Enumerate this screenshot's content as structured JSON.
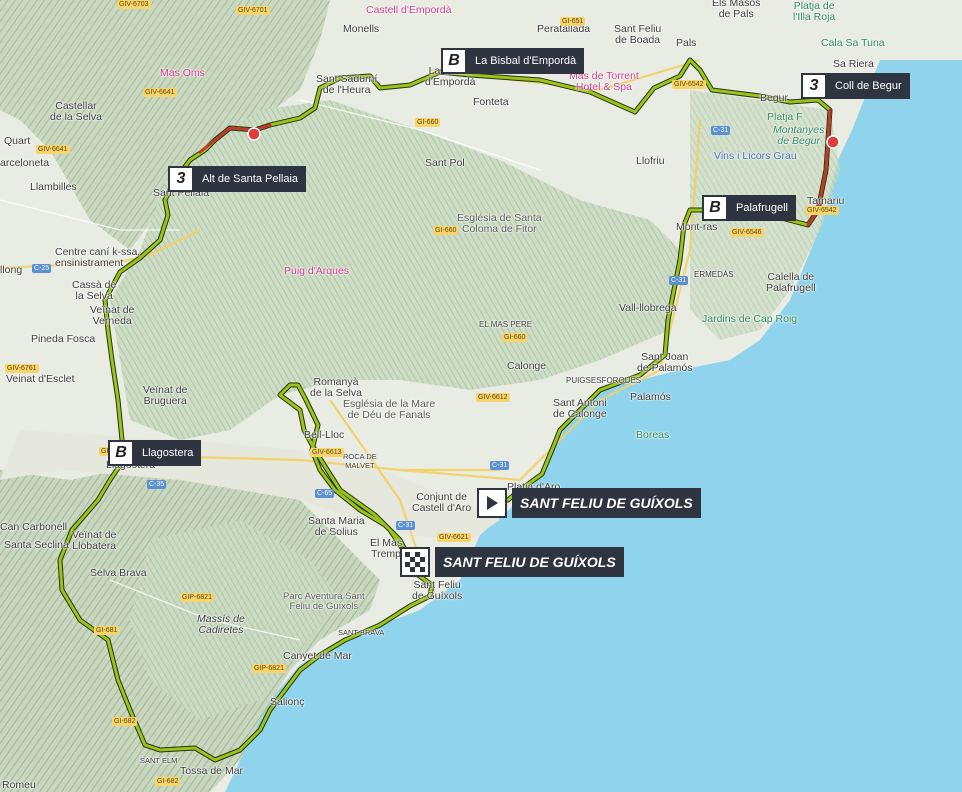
{
  "map": {
    "places": [
      {
        "id": "monells",
        "text": "Monells"
      },
      {
        "id": "peratallada",
        "text": "Peratallada"
      },
      {
        "id": "santfeliuboada",
        "text": "Sant Feliu\nde Boada"
      },
      {
        "id": "masos",
        "text": "Els Masos\nde Pals"
      },
      {
        "id": "pals",
        "text": "Pals"
      },
      {
        "id": "castellar",
        "text": "Castellar\nde la Selva"
      },
      {
        "id": "quart",
        "text": "Quart"
      },
      {
        "id": "barcelona",
        "text": "arceloneta"
      },
      {
        "id": "llambilles",
        "text": "Llambilles"
      },
      {
        "id": "santsadurni",
        "text": "Sant Sadurní\nde l'Heura"
      },
      {
        "id": "labisbal",
        "text": "La Bisbal\nd'Empordà"
      },
      {
        "id": "fonteta",
        "text": "Fonteta"
      },
      {
        "id": "santpol",
        "text": "Sant Pol"
      },
      {
        "id": "llofriu",
        "text": "Llofriu"
      },
      {
        "id": "santpellaia",
        "text": "Sant Pellaia"
      },
      {
        "id": "centrecani",
        "text": "Centre caní k-ssa,\nensinistrament"
      },
      {
        "id": "llong",
        "text": "llong"
      },
      {
        "id": "cassa",
        "text": "Cassà de\nla Selva"
      },
      {
        "id": "veinatverneda",
        "text": "Veïnat de\nVerneda"
      },
      {
        "id": "pineda",
        "text": "Pineda Fosca"
      },
      {
        "id": "veinatesclet",
        "text": "Veinat d'Esclet"
      },
      {
        "id": "veinatbruguera",
        "text": "Veïnat de\nBruguera"
      },
      {
        "id": "romanya",
        "text": "Romanyà\nde la Selva"
      },
      {
        "id": "elmaspere",
        "text": "EL MAS PERE"
      },
      {
        "id": "calonge",
        "text": "Calonge"
      },
      {
        "id": "vallllobrega",
        "text": "Vall-llobrega"
      },
      {
        "id": "montras",
        "text": "Mont-ras"
      },
      {
        "id": "ermedas",
        "text": "ERMEDÀS"
      },
      {
        "id": "calella",
        "text": "Calella de\nPalafrugell"
      },
      {
        "id": "jardins",
        "text": "Jardins de Cap Roig"
      },
      {
        "id": "santjoan",
        "text": "Sant Joan\nde Palamós"
      },
      {
        "id": "puigses",
        "text": "PUIGSESFORQUES"
      },
      {
        "id": "palamos",
        "text": "Palamós"
      },
      {
        "id": "santantoni",
        "text": "Sant Antoni\nde Calonge"
      },
      {
        "id": "boreas",
        "text": "Boreas"
      },
      {
        "id": "bellloc",
        "text": "Bell-Lloc"
      },
      {
        "id": "rocamalvet",
        "text": "ROCA DE\nMALVET"
      },
      {
        "id": "platjaaro",
        "text": "Platja d'Aro"
      },
      {
        "id": "conjunt",
        "text": "Conjunt de\nCastell d'Aro"
      },
      {
        "id": "santamaria",
        "text": "Santa Maria\nde Solius"
      },
      {
        "id": "elmas",
        "text": "El Mas\nTremp"
      },
      {
        "id": "santfeliu",
        "text": "Sant Feliu\nde Guíxols"
      },
      {
        "id": "llagostera",
        "text": "Llagostera"
      },
      {
        "id": "cancarbonell",
        "text": "Can Carbonell"
      },
      {
        "id": "santasecl",
        "text": "Santa Seclina"
      },
      {
        "id": "veinatllobatera",
        "text": "Veïnat de\nLlobatera"
      },
      {
        "id": "selvabrava",
        "text": "Selva Brava"
      },
      {
        "id": "parc",
        "text": "Parc Aventura Sant\nFeliu de Guíxols"
      },
      {
        "id": "massis",
        "text": "Massís de\nCadiretes"
      },
      {
        "id": "santbrava",
        "text": "SANT BRAVA"
      },
      {
        "id": "canyet",
        "text": "Canyet de Mar"
      },
      {
        "id": "salions",
        "text": "Salionç"
      },
      {
        "id": "santelm",
        "text": "SANT ELM"
      },
      {
        "id": "tossa",
        "text": "Tossa de Mar"
      },
      {
        "id": "romeu",
        "text": "Romeu"
      },
      {
        "id": "calasatuna",
        "text": "Cala Sa Tuna"
      },
      {
        "id": "sariera",
        "text": "Sa Riera"
      },
      {
        "id": "begur",
        "text": "Begur"
      },
      {
        "id": "tamariu",
        "text": "Tamariu"
      },
      {
        "id": "platjafr",
        "text": "Platja F"
      },
      {
        "id": "platjaillaroja",
        "text": "Platja de\nl'Illa Roja"
      },
      {
        "id": "montanyes",
        "text": "Montanyes\nde Begur"
      }
    ],
    "pois": [
      {
        "id": "masoms",
        "text": "Mas Oms"
      },
      {
        "id": "castell",
        "text": "Castell d'Empordà"
      },
      {
        "id": "mastorrent",
        "text": "Mas de Torrent\nHotel & Spa"
      },
      {
        "id": "vins",
        "text": "Vins i Licors Grau"
      },
      {
        "id": "esglesia1",
        "text": "Església de Santa\nColoma de Fitor"
      },
      {
        "id": "puig",
        "text": "Puig d'Arques"
      },
      {
        "id": "esglesia2",
        "text": "Església de la Mare\nde Déu de Fanals"
      }
    ],
    "roads": [
      {
        "id": "r1",
        "text": "GIV-6703"
      },
      {
        "id": "r2",
        "text": "GIV-6701"
      },
      {
        "id": "r3",
        "text": "GI-651"
      },
      {
        "id": "r4",
        "text": "GIV-6641"
      },
      {
        "id": "r5",
        "text": "GIV-6641"
      },
      {
        "id": "r6",
        "text": "GI-660"
      },
      {
        "id": "r7",
        "text": "GI-660"
      },
      {
        "id": "r8",
        "text": "C-31"
      },
      {
        "id": "r9",
        "text": "GIV-6546"
      },
      {
        "id": "r10",
        "text": "C-25"
      },
      {
        "id": "r11",
        "text": "GIV-6761"
      },
      {
        "id": "r12",
        "text": "GI-660"
      },
      {
        "id": "r13",
        "text": "GIV-6612"
      },
      {
        "id": "r14",
        "text": "C-65"
      },
      {
        "id": "r15",
        "text": "C-35"
      },
      {
        "id": "r16",
        "text": "C-31"
      },
      {
        "id": "r17",
        "text": "GIV-6613"
      },
      {
        "id": "r18",
        "text": "GIV-6621"
      },
      {
        "id": "r19",
        "text": "GIP-6821"
      },
      {
        "id": "r20",
        "text": "GIP-6821"
      },
      {
        "id": "r21",
        "text": "GI-682"
      },
      {
        "id": "r22",
        "text": "GI-682"
      },
      {
        "id": "r23",
        "text": "C-31"
      },
      {
        "id": "r24",
        "text": "C-31"
      },
      {
        "id": "r25",
        "text": "GIV-6542"
      },
      {
        "id": "r26",
        "text": "GIV-6542"
      },
      {
        "id": "r27",
        "text": "GI-681"
      },
      {
        "id": "r28",
        "text": "GIV-674"
      }
    ],
    "markers": [
      {
        "id": "labisbal",
        "badge": "B",
        "label": "La Bisbal d'Empordà"
      },
      {
        "id": "collbegur",
        "badge": "3",
        "label": "Coll de Begur"
      },
      {
        "id": "santpellaia",
        "badge": "3",
        "label": "Alt de Santa Pellaia"
      },
      {
        "id": "palafrugell",
        "badge": "B",
        "label": "Palafrugell"
      },
      {
        "id": "llagostera",
        "badge": "B",
        "label": "Llagostera"
      }
    ],
    "start": {
      "label": "SANT FELIU DE GUÍXOLS"
    },
    "finish": {
      "label": "SANT FELIU DE GUÍXOLS"
    },
    "colors": {
      "route": "#9cc31a",
      "route_outline": "#23330f",
      "climb": "#c0392b",
      "sea": "#8fd3ec",
      "land": "#e9ece3",
      "relief": "#b8cbb0",
      "forest": "#cfe2c6"
    }
  }
}
